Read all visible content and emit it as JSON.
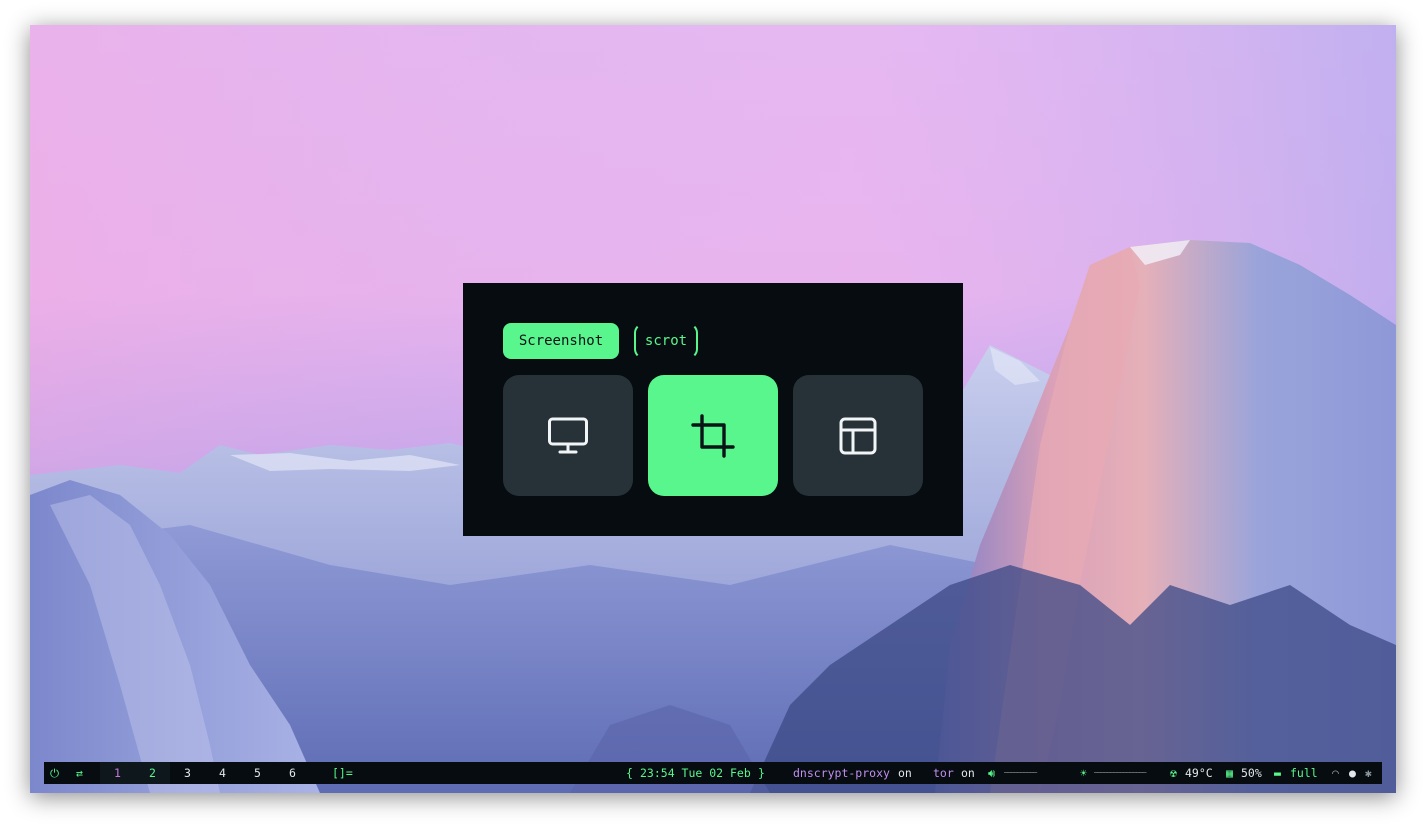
{
  "menu": {
    "title": "Screenshot",
    "command": "scrot",
    "options": [
      {
        "icon": "monitor-icon",
        "label": "fullscreen",
        "active": false
      },
      {
        "icon": "crop-icon",
        "label": "selection",
        "active": true
      },
      {
        "icon": "window-icon",
        "label": "window",
        "active": false
      }
    ]
  },
  "bar": {
    "workspaces": [
      "1",
      "2",
      "3",
      "4",
      "5",
      "6"
    ],
    "layout": "[]=",
    "clock": "23:54 Tue 02 Feb",
    "dnscrypt_label": "dnscrypt-proxy",
    "dnscrypt_state": "on",
    "tor_label": "tor",
    "tor_state": "on",
    "volume_bar": "──────────",
    "brightness_bar": "────────────────",
    "temperature": "49°C",
    "cpu": "50%",
    "battery": "full"
  },
  "colors": {
    "accent": "#59f68d",
    "panel_bg": "#060c0f",
    "tile_bg": "#273238",
    "purple": "#c08ff0"
  }
}
